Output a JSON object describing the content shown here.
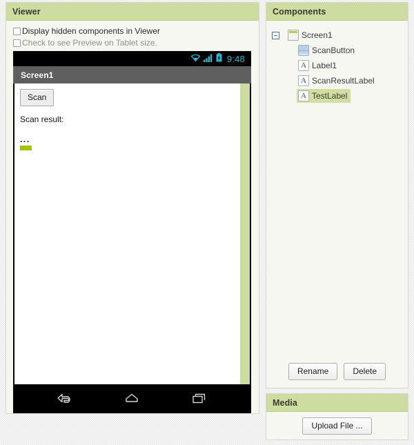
{
  "viewer": {
    "header_title": "Viewer",
    "options": [
      {
        "label": "Display hidden components in Viewer",
        "checked": false,
        "dim": false
      },
      {
        "label": "Check to see Preview on Tablet size.",
        "checked": false,
        "dim": true
      }
    ],
    "phone": {
      "status_bar": {
        "time": "9:48",
        "icons": [
          "wifi-icon",
          "signal-icon",
          "battery-charging-icon"
        ],
        "icon_color": "#2eb6d6"
      },
      "title_bar": {
        "title": "Screen1",
        "background": "#5f5f5f"
      },
      "canvas": {
        "scan_button_label": "Scan",
        "scan_result_label": "Scan result:",
        "dots_label": "...",
        "selected_label_name": "TestLabel",
        "selection_color": "#9ec40c",
        "scroll_indicator_color": "#cddc9f"
      },
      "nav_bar": {
        "icons": [
          "back-icon",
          "home-icon",
          "recents-icon"
        ]
      }
    }
  },
  "components": {
    "header_title": "Components",
    "tree": [
      {
        "label": "Screen1",
        "icon": "screen-icon",
        "depth": 0,
        "expanded": true,
        "selected": false
      },
      {
        "label": "ScanButton",
        "icon": "button-icon",
        "depth": 1,
        "expanded": null,
        "selected": false
      },
      {
        "label": "Label1",
        "icon": "label-icon",
        "depth": 1,
        "expanded": null,
        "selected": false
      },
      {
        "label": "ScanResultLabel",
        "icon": "label-icon",
        "depth": 1,
        "expanded": null,
        "selected": false
      },
      {
        "label": "TestLabel",
        "icon": "label-icon",
        "depth": 1,
        "expanded": null,
        "selected": true
      }
    ],
    "buttons": {
      "rename": "Rename",
      "delete": "Delete"
    },
    "selection_highlight_color": "#d0de9f"
  },
  "media": {
    "header_title": "Media",
    "upload_button_label": "Upload File ..."
  },
  "theme": {
    "panel_header_green": "#cddc9f",
    "panel_background": "#f7f7f2",
    "page_background": "#e9e9e9",
    "accent_cyan": "#2eb6d6"
  }
}
